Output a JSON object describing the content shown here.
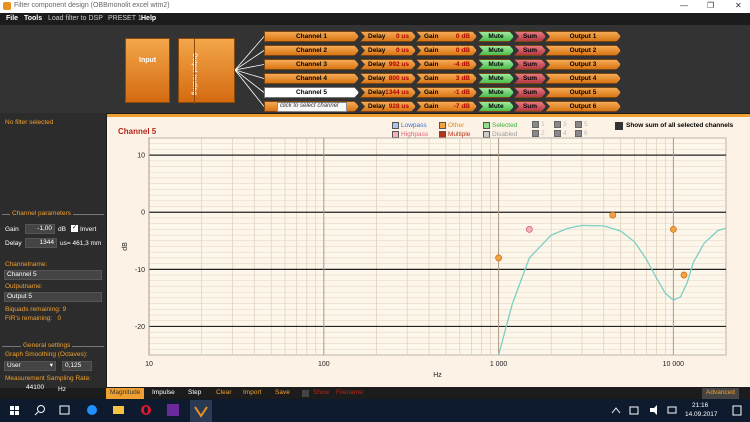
{
  "window": {
    "title": "Filter component design (OBBmonolit excel wtm2)"
  },
  "menu": [
    "File",
    "Tools",
    "Load filter to DSP",
    "PRESET 1",
    "Help"
  ],
  "routing": {
    "input_label": "Input",
    "output_routing_label": "Output routing",
    "tooltip": "click to select channel",
    "channels": [
      {
        "name": "Channel 1",
        "delay_label": "Delay",
        "delay": "0 us",
        "gain_label": "Gain",
        "gain": "0 dB",
        "mute": "Mute",
        "sum": "Sum",
        "output": "Output 1"
      },
      {
        "name": "Channel 2",
        "delay_label": "Delay",
        "delay": "0 us",
        "gain_label": "Gain",
        "gain": "0 dB",
        "mute": "Mute",
        "sum": "Sum",
        "output": "Output 2"
      },
      {
        "name": "Channel 3",
        "delay_label": "Delay",
        "delay": "992 us",
        "gain_label": "Gain",
        "gain": "-4 dB",
        "mute": "Mute",
        "sum": "Sum",
        "output": "Output 3"
      },
      {
        "name": "Channel 4",
        "delay_label": "Delay",
        "delay": "800 us",
        "gain_label": "Gain",
        "gain": "3 dB",
        "mute": "Mute",
        "sum": "Sum",
        "output": "Output 4"
      },
      {
        "name": "Channel 5",
        "delay_label": "Delay",
        "delay": "1344 us",
        "gain_label": "Gain",
        "gain": "-1 dB",
        "mute": "Mute",
        "sum": "Sum",
        "output": "Output 5",
        "selected": true
      },
      {
        "name": "Channel 6",
        "delay_label": "Delay",
        "delay": "928 us",
        "gain_label": "Gain",
        "gain": "-7 dB",
        "mute": "Mute",
        "sum": "Sum",
        "output": "Output 6"
      }
    ]
  },
  "left_panel": {
    "no_filter": "No filter selected",
    "channel_params_title": "Channel parameters",
    "gain_label": "Gain",
    "gain_value": "-1,00",
    "gain_unit": "dB",
    "invert_label": "Invert",
    "invert_checked": true,
    "delay_label": "Delay",
    "delay_value": "1344",
    "delay_unit": "us= 461,3 mm",
    "channelname_label": "Channelname:",
    "channelname_value": "Channel 5",
    "outputname_label": "Outputname:",
    "outputname_value": "Output 5",
    "biquads": "Biquads remaining: 9",
    "firs": "FIR's remaining:   0",
    "general_title": "General settings",
    "smoothing_label": "Graph Smoothing (Octaves):",
    "smoothing_mode": "User",
    "smoothing_value": "0,125",
    "sampling_label": "Measurement Sampling Rate:",
    "sampling_value": "44100",
    "sampling_unit": "Hz"
  },
  "plot": {
    "title": "Channel 5",
    "legend": [
      {
        "label": "Lowpass",
        "color": "#aac4ef",
        "text": "#3a6fd0"
      },
      {
        "label": "Highpass",
        "color": "#f5b0b8",
        "text": "#e0607a"
      },
      {
        "label": "Other",
        "color": "#f5a142",
        "text": "#e08a20"
      },
      {
        "label": "Multiple",
        "color": "#b83218",
        "text": "#b83218"
      },
      {
        "label": "Selected",
        "color": "#8fe08f",
        "text": "#3bb03b"
      },
      {
        "label": "Disabled",
        "color": "#cccccc",
        "text": "#999999"
      }
    ],
    "num_grid": [
      "1",
      "2",
      "3",
      "4",
      "5",
      "6"
    ],
    "show_sum_label": "Show sum of all selected channels",
    "curve_color": "#7ccfc6"
  },
  "chart_data": {
    "type": "line",
    "xlabel": "Hz",
    "ylabel": "dB",
    "x_scale": "log",
    "xlim": [
      10,
      20000
    ],
    "ylim": [
      -25,
      13
    ],
    "x_ticks": [
      "10",
      "100",
      "1 000",
      "10 000"
    ],
    "y_ticks": [
      "10",
      "0",
      "-10",
      "-20"
    ],
    "series": [
      {
        "x": [
          1000,
          1200,
          1500,
          2000,
          2500,
          3000,
          4000,
          5000,
          6000,
          7000,
          8000,
          9000,
          10000,
          11000,
          12000,
          13000,
          15000,
          18000,
          20000
        ],
        "y": [
          -25,
          -16,
          -8,
          -4,
          -2.8,
          -2.3,
          -2.4,
          -3.3,
          -5.2,
          -8.2,
          -11.5,
          -14.2,
          -15.4,
          -14.8,
          -12.3,
          -8.8,
          -5.4,
          -3.2,
          -2.8
        ]
      }
    ],
    "points": [
      {
        "x": 1000,
        "y": -8,
        "kind": "Other"
      },
      {
        "x": 1500,
        "y": -3,
        "kind": "Highpass"
      },
      {
        "x": 4500,
        "y": -0.5,
        "kind": "Other"
      },
      {
        "x": 10000,
        "y": -3,
        "kind": "Other"
      },
      {
        "x": 11500,
        "y": -11,
        "kind": "Other"
      }
    ],
    "grid": true
  },
  "bottom": {
    "tabs": [
      "Magnitude",
      "Impulse",
      "Step"
    ],
    "buttons": [
      "Clear",
      "Import",
      "Save"
    ],
    "show_label": "Show",
    "filename_label": "Filename:",
    "advanced": "Advanced"
  },
  "taskbar": {
    "time": "21:16",
    "date": "14.09.2017"
  }
}
